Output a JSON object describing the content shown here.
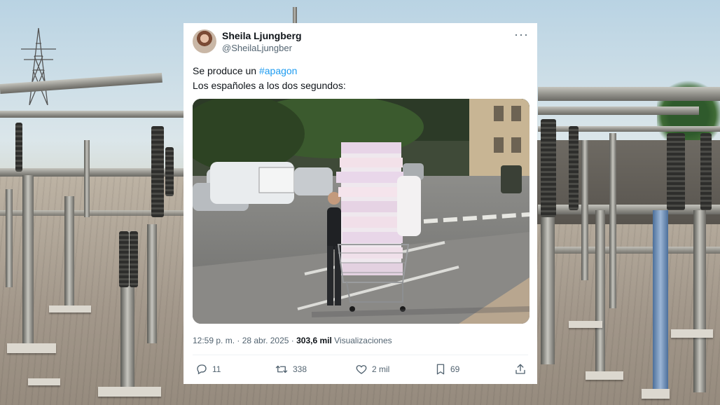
{
  "tweet": {
    "display_name": "Sheila Ljungberg",
    "handle": "@SheilaLjungber",
    "text_prefix": "Se produce un ",
    "hashtag": "#apagon",
    "text_line2": "Los españoles a los dos segundos:",
    "timestamp": "12:59 p. m. · 28 abr. 2025 · ",
    "views_count": "303,6 mil",
    "views_label": " Visualizaciones"
  },
  "actions": {
    "replies": "11",
    "reposts": "338",
    "likes": "2 mil",
    "bookmarks": "69"
  },
  "colors": {
    "accent": "#1d9bf0",
    "text_primary": "#0f1419",
    "text_secondary": "#536471"
  },
  "icons": [
    "more-options-icon",
    "reply-icon",
    "repost-icon",
    "like-icon",
    "bookmark-icon",
    "share-icon"
  ]
}
